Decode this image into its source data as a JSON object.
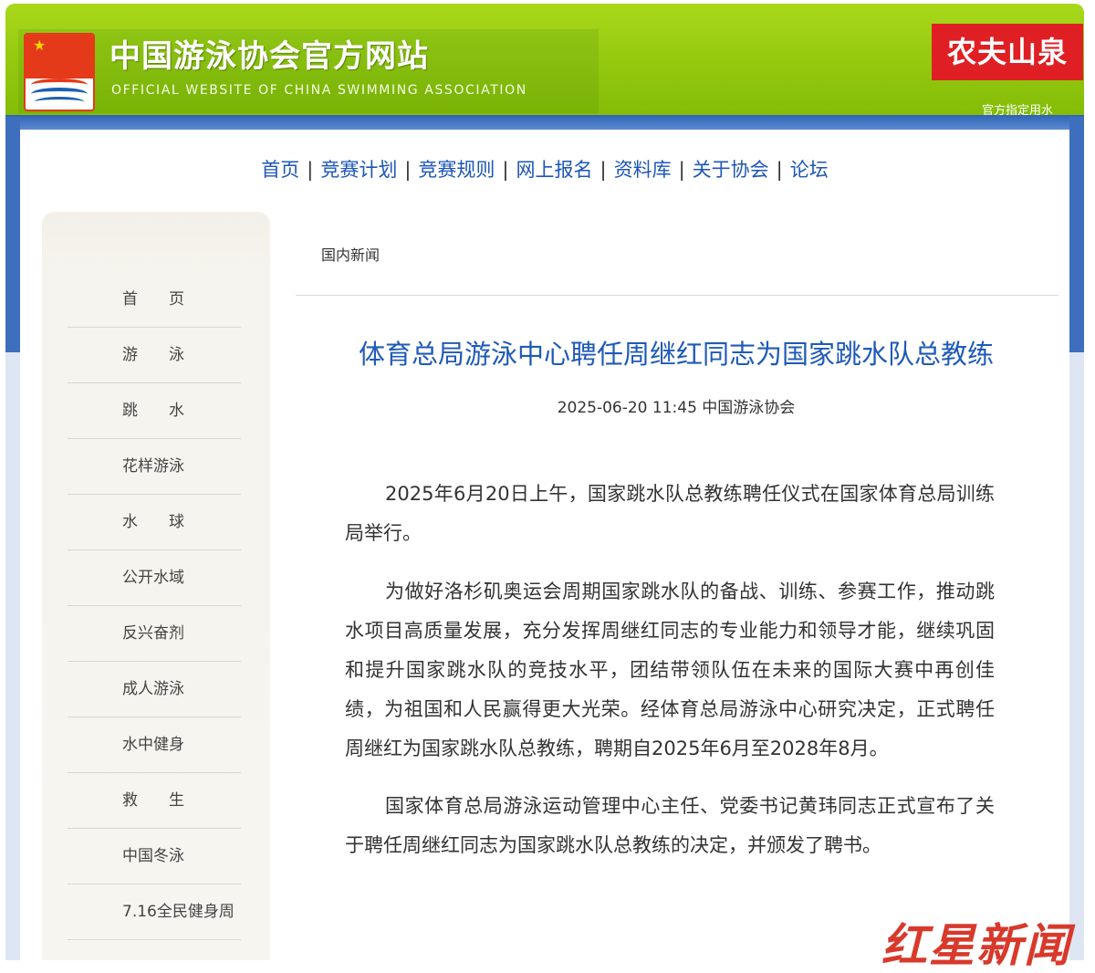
{
  "header": {
    "title": "中国游泳协会官方网站",
    "subtitle": "OFFICIAL WEBSITE OF CHINA SWIMMING ASSOCIATION",
    "sponsor": "农夫山泉",
    "sponsor_link": "官方指定用水"
  },
  "nav": {
    "items": [
      "首页",
      "竞赛计划",
      "竞赛规则",
      "网上报名",
      "资料库",
      "关于协会",
      "论坛"
    ],
    "separator": "|"
  },
  "sidebar": {
    "items": [
      "首　　页",
      "游　　泳",
      "跳　　水",
      "花样游泳",
      "水　　球",
      "公开水域",
      "反兴奋剂",
      "成人游泳",
      "水中健身",
      "救　　生",
      "中国冬泳",
      "7.16全民健身周"
    ]
  },
  "breadcrumb": "国内新闻",
  "article": {
    "title": "体育总局游泳中心聘任周继红同志为国家跳水队总教练",
    "meta": "2025-06-20 11:45 中国游泳协会",
    "paragraphs": [
      "2025年6月20日上午，国家跳水队总教练聘任仪式在国家体育总局训练局举行。",
      "为做好洛杉矶奥运会周期国家跳水队的备战、训练、参赛工作，推动跳水项目高质量发展，充分发挥周继红同志的专业能力和领导才能，继续巩固和提升国家跳水队的竞技水平，团结带领队伍在未来的国际大赛中再创佳绩，为祖国和人民赢得更大光荣。经体育总局游泳中心研究决定，正式聘任周继红为国家跳水队总教练，聘期自2025年6月至2028年8月。",
      "国家体育总局游泳运动管理中心主任、党委书记黄玮同志正式宣布了关于聘任周继红同志为国家跳水队总教练的决定，并颁发了聘书。"
    ]
  },
  "watermark": "红星新闻",
  "colors": {
    "header_green": "#93c80e",
    "frame_blue": "#3e6fbe",
    "link_blue": "#1d56b8",
    "sponsor_red": "#e01f24"
  }
}
